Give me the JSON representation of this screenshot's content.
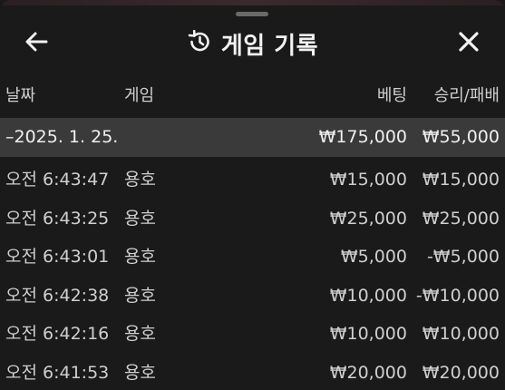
{
  "header": {
    "title": "게임 기록",
    "back_icon": "arrow-left-icon",
    "history_icon": "history-icon",
    "close_icon": "close-icon"
  },
  "columns": {
    "date": "날짜",
    "game": "게임",
    "bet": "베팅",
    "result": "승리/패배"
  },
  "group": {
    "label": "–2025. 1. 25.",
    "bet": "₩175,000",
    "result": "₩55,000"
  },
  "rows": [
    {
      "time": "오전 6:43:47",
      "game": "용호",
      "bet": "₩15,000",
      "result": "₩15,000"
    },
    {
      "time": "오전 6:43:25",
      "game": "용호",
      "bet": "₩25,000",
      "result": "₩25,000"
    },
    {
      "time": "오전 6:43:01",
      "game": "용호",
      "bet": "₩5,000",
      "result": "-₩5,000"
    },
    {
      "time": "오전 6:42:38",
      "game": "용호",
      "bet": "₩10,000",
      "result": "-₩10,000"
    },
    {
      "time": "오전 6:42:16",
      "game": "용호",
      "bet": "₩10,000",
      "result": "₩10,000"
    },
    {
      "time": "오전 6:41:53",
      "game": "용호",
      "bet": "₩20,000",
      "result": "₩20,000"
    }
  ],
  "colors": {
    "background": "#1a1a1a",
    "group_row": "#3a3a3a",
    "text": "#cfcfcf"
  }
}
